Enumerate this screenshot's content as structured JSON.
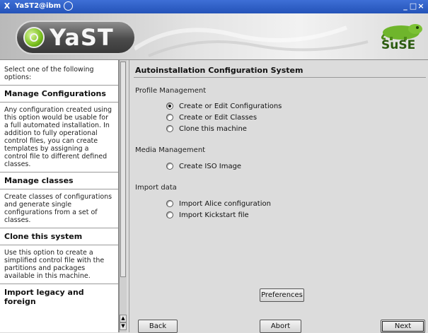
{
  "window": {
    "title": "YaST2@ibm",
    "controls": {
      "minimize": "_",
      "maximize": "□",
      "close": "×"
    }
  },
  "banner": {
    "yast_logo_text": "YaST",
    "suse_logo_text": "SuSE"
  },
  "help": {
    "intro": "Select one of the following options:",
    "sections": [
      {
        "heading": "Manage Configurations",
        "text": "Any configuration created using this option would be usable for a full automated installation. In addition to fully operational control files, you can create templates by assigning a control file to different defined classes."
      },
      {
        "heading": "Manage classes",
        "text": "Create classes of configurations and generate single configurations from a set of classes."
      },
      {
        "heading": "Clone this system",
        "text": "Use this option to create a simplified control file with the partitions and packages available in this machine."
      },
      {
        "heading": "Import legacy and foreign",
        "text": ""
      }
    ]
  },
  "main": {
    "title": "Autoinstallation Configuration System",
    "groups": [
      {
        "label": "Profile Management",
        "options": [
          {
            "label": "Create or Edit Configurations",
            "checked": true
          },
          {
            "label": "Create or Edit Classes",
            "checked": false
          },
          {
            "label": "Clone this machine",
            "checked": false
          }
        ]
      },
      {
        "label": "Media Management",
        "options": [
          {
            "label": "Create ISO Image",
            "checked": false
          }
        ]
      },
      {
        "label": "Import data",
        "options": [
          {
            "label": "Import Alice configuration",
            "checked": false
          },
          {
            "label": "Import Kickstart file",
            "checked": false
          }
        ]
      }
    ],
    "buttons": {
      "preferences": "Preferences",
      "back": "Back",
      "abort": "Abort",
      "next": "Next"
    }
  }
}
